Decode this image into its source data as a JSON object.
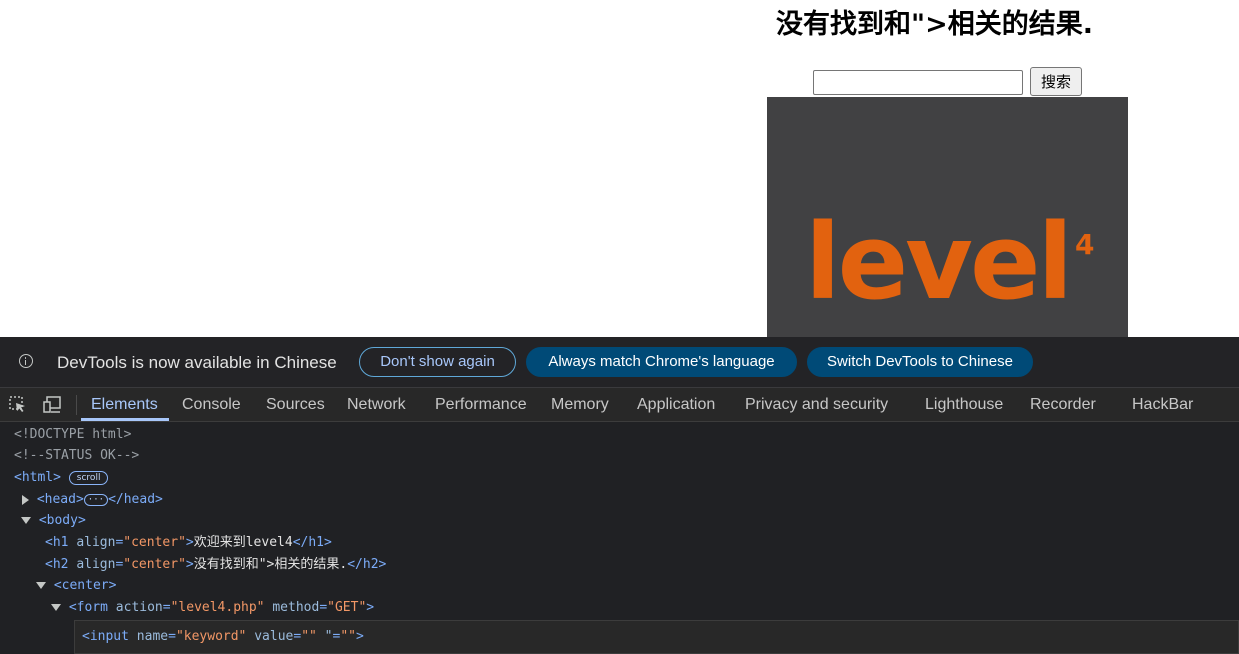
{
  "page": {
    "heading": "没有找到和\">相关的结果.",
    "search_button_label": "搜索",
    "logo_text": "level",
    "logo_superscript": "4"
  },
  "devtools": {
    "infobar": {
      "message": "DevTools is now available in Chinese",
      "dont_show_label": "Don't show again",
      "always_match_label": "Always match Chrome's language",
      "switch_label": "Switch DevTools to Chinese"
    },
    "tabs": [
      "Elements",
      "Console",
      "Sources",
      "Network",
      "Performance",
      "Memory",
      "Application",
      "Privacy and security",
      "Lighthouse",
      "Recorder",
      "HackBar"
    ],
    "active_tab": "Elements",
    "dom": {
      "doctype": "<!DOCTYPE html>",
      "comment": "<!--STATUS OK-->",
      "html_open": "<html>",
      "scroll_badge": "scroll",
      "head_open": "<head>",
      "head_ellipsis": "···",
      "head_close": "</head>",
      "body_open": "<body>",
      "h1_open": "<h1 ",
      "h1_attr": "align",
      "h1_val": "\"center\"",
      "h1_text": "欢迎来到level4",
      "h1_close": "</h1>",
      "h2_open": "<h2 ",
      "h2_attr": "align",
      "h2_val": "\"center\"",
      "h2_text": "没有找到和\">相关的结果.",
      "h2_close": "</h2>",
      "center_open": "<center>",
      "form_open": "<form ",
      "form_attr1": "action",
      "form_val1": "\"level4.php\"",
      "form_attr2": "method",
      "form_val2": "\"GET\"",
      "form_end": ">",
      "input_open": "<input ",
      "input_attr1": "name",
      "input_val1": "\"keyword\"",
      "input_attr2": "value",
      "input_val2": "\"\"",
      "input_attr3": "\"",
      "input_val3": "\"\"",
      "input_end": ">"
    }
  }
}
